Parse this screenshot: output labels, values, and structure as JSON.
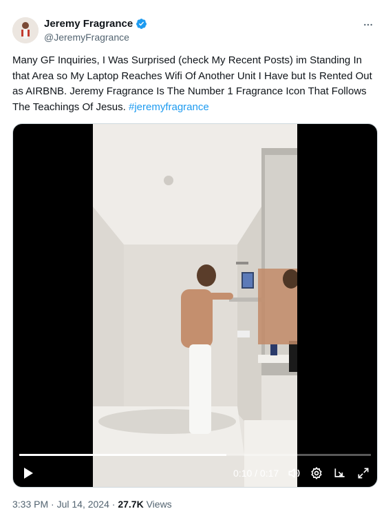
{
  "author": {
    "display_name": "Jeremy Fragrance",
    "handle": "@JeremyFragrance",
    "verified": true
  },
  "tweet": {
    "text": "Many GF Inquiries, I Was Surprised (check My Recent Posts) im Standing In that Area so My Laptop Reaches Wifi Of Another Unit I Have but Is Rented Out as AIRBNB. Jeremy Fragrance Is The Number 1 Fragrance Icon That Follows The Teachings Of Jesus.",
    "hashtag": "#jeremyfragrance"
  },
  "video": {
    "current_time": "0:10",
    "separator": "/",
    "duration": "0:17",
    "progress": 0.5882
  },
  "meta": {
    "time": "3:33 PM",
    "dot1": "·",
    "date": "Jul 14, 2024",
    "dot2": "·",
    "views_count": "27.7K",
    "views_label": "Views"
  },
  "colors": {
    "accent": "#1d9bf0",
    "text": "#0f1419",
    "secondary": "#536471"
  },
  "icons": {
    "avatar": "avatar",
    "verified": "verified-badge-icon",
    "more": "more-icon",
    "play": "play-icon",
    "volume": "volume-icon",
    "settings": "settings-gear-icon",
    "pip": "picture-in-picture-icon",
    "fullscreen": "fullscreen-icon"
  }
}
